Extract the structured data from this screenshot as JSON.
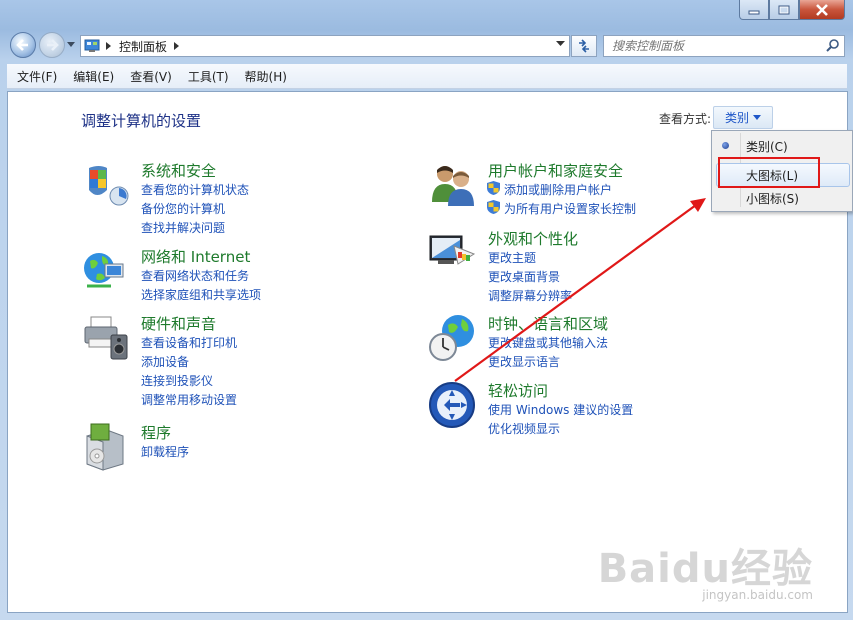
{
  "window": {
    "caption_buttons": [
      "minimize-icon",
      "maximize-icon",
      "close-icon"
    ]
  },
  "address": {
    "crumb": "控制面板",
    "search_placeholder": "搜索控制面板"
  },
  "menubar": [
    "文件(F)",
    "编辑(E)",
    "查看(V)",
    "工具(T)",
    "帮助(H)"
  ],
  "page": {
    "title": "调整计算机的设置",
    "view_by_label": "查看方式:",
    "view_by_value": "类别"
  },
  "categories_left": [
    {
      "icon": "shield-flag-icon",
      "title": "系统和安全",
      "links": [
        "查看您的计算机状态",
        "备份您的计算机",
        "查找并解决问题"
      ]
    },
    {
      "icon": "globe-network-icon",
      "title": "网络和 Internet",
      "links": [
        "查看网络状态和任务",
        "选择家庭组和共享选项"
      ]
    },
    {
      "icon": "printer-speaker-icon",
      "title": "硬件和声音",
      "links": [
        "查看设备和打印机",
        "添加设备",
        "连接到投影仪",
        "调整常用移动设置"
      ]
    },
    {
      "icon": "programs-box-icon",
      "title": "程序",
      "links": [
        "卸载程序"
      ]
    }
  ],
  "categories_right": [
    {
      "icon": "users-icon",
      "title": "用户帐户和家庭安全",
      "links": [
        "添加或删除用户帐户",
        "为所有用户设置家长控制"
      ]
    },
    {
      "icon": "monitor-palette-icon",
      "title": "外观和个性化",
      "links": [
        "更改主题",
        "更改桌面背景",
        "调整屏幕分辨率"
      ]
    },
    {
      "icon": "clock-globe-icon",
      "title": "时钟、语言和区域",
      "links": [
        "更改键盘或其他输入法",
        "更改显示语言"
      ]
    },
    {
      "icon": "ease-of-access-icon",
      "title": "轻松访问",
      "links": [
        "使用 Windows 建议的设置",
        "优化视频显示"
      ]
    }
  ],
  "view_menu": {
    "items": [
      "类别(C)",
      "大图标(L)",
      "小图标(S)"
    ],
    "selected": "类别(C)",
    "hovered": "大图标(L)"
  },
  "annotation": {
    "highlight_color": "#e01818"
  },
  "watermark": {
    "brand": "Baidu经验",
    "url": "jingyan.baidu.com"
  }
}
